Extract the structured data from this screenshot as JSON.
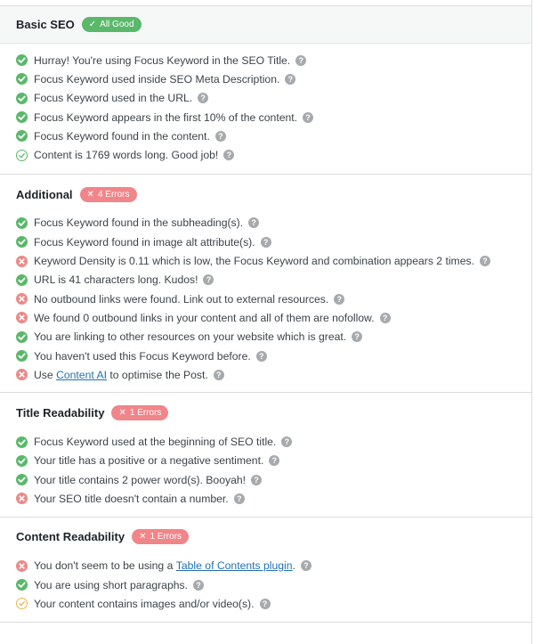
{
  "sections": {
    "basic": {
      "title": "Basic SEO",
      "badge": "All Good",
      "items": [
        {
          "text": "Hurray! You're using Focus Keyword in the SEO Title."
        },
        {
          "text": "Focus Keyword used inside SEO Meta Description."
        },
        {
          "text": "Focus Keyword used in the URL."
        },
        {
          "text": "Focus Keyword appears in the first 10% of the content."
        },
        {
          "text": "Focus Keyword found in the content."
        },
        {
          "text": "Content is 1769 words long. Good job!"
        }
      ]
    },
    "additional": {
      "title": "Additional",
      "badge": "4 Errors",
      "items": [
        {
          "text": "Focus Keyword found in the subheading(s)."
        },
        {
          "text": "Focus Keyword found in image alt attribute(s)."
        },
        {
          "text": "Keyword Density is 0.11 which is low, the Focus Keyword and combination appears 2 times."
        },
        {
          "text": "URL is 41 characters long. Kudos!"
        },
        {
          "text": "No outbound links were found. Link out to external resources."
        },
        {
          "text": "We found 0 outbound links in your content and all of them are nofollow."
        },
        {
          "text": "You are linking to other resources on your website which is great."
        },
        {
          "text": "You haven't used this Focus Keyword before."
        },
        {
          "pre": "Use ",
          "link": "Content AI",
          "post": " to optimise the Post."
        }
      ]
    },
    "title_readability": {
      "title": "Title Readability",
      "badge": "1 Errors",
      "items": [
        {
          "text": "Focus Keyword used at the beginning of SEO title."
        },
        {
          "text": "Your title has a positive or a negative sentiment."
        },
        {
          "text": "Your title contains 2 power word(s). Booyah!"
        },
        {
          "text": "Your SEO title doesn't contain a number."
        }
      ]
    },
    "content_readability": {
      "title": "Content Readability",
      "badge": "1 Errors",
      "items": [
        {
          "pre": "You don't seem to be using a ",
          "link": "Table of Contents plugin",
          "post": "."
        },
        {
          "text": "You are using short paragraphs."
        },
        {
          "text": "Your content contains images and/or video(s)."
        }
      ]
    }
  },
  "help_glyph": "?",
  "icons": {
    "pass": "check-circle-icon",
    "fail": "x-circle-icon",
    "pass_outline": "check-circle-outline-icon",
    "warn_outline": "check-circle-warning-icon"
  },
  "colors": {
    "pass": "#5ab86a",
    "fail": "#ea8a8a",
    "warning": "#e6b54a",
    "link": "#2271b1"
  }
}
